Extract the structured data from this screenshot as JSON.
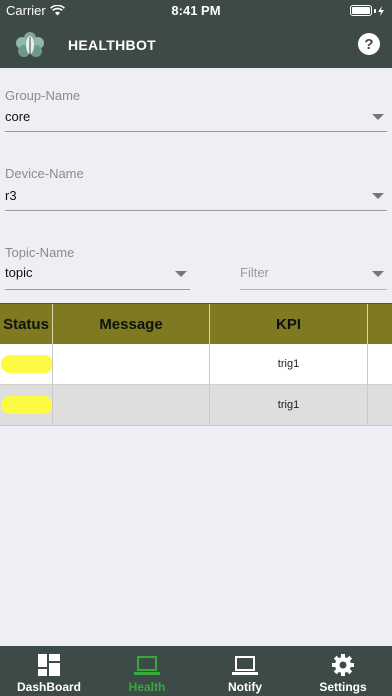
{
  "status_bar": {
    "carrier": "Carrier",
    "time": "8:41 PM"
  },
  "header": {
    "title": "HEALTHBOT",
    "help_icon": "question-circle-icon"
  },
  "fields": {
    "group": {
      "label": "Group-Name",
      "value": "core"
    },
    "device": {
      "label": "Device-Name",
      "value": "r3"
    },
    "topic": {
      "label": "Topic-Name",
      "value": "topic"
    },
    "filter": {
      "placeholder": "Filter"
    }
  },
  "table": {
    "headers": [
      "Status",
      "Message",
      "KPI"
    ],
    "rows": [
      {
        "status_color": "#fdfa43",
        "message": "",
        "kpi": "trig1"
      },
      {
        "status_color": "#fdfa43",
        "message": "",
        "kpi": "trig1"
      }
    ]
  },
  "tabs": [
    {
      "label": "DashBoard",
      "icon": "dashboard-grid-icon",
      "active": false
    },
    {
      "label": "Health",
      "icon": "laptop-icon",
      "active": true
    },
    {
      "label": "Notify",
      "icon": "laptop-icon",
      "active": false
    },
    {
      "label": "Settings",
      "icon": "gear-icon",
      "active": false
    }
  ],
  "colors": {
    "header": "#3d4a47",
    "table_header": "#7f7a22",
    "active_tab": "#37a93c",
    "status_yellow": "#fdfa43"
  }
}
